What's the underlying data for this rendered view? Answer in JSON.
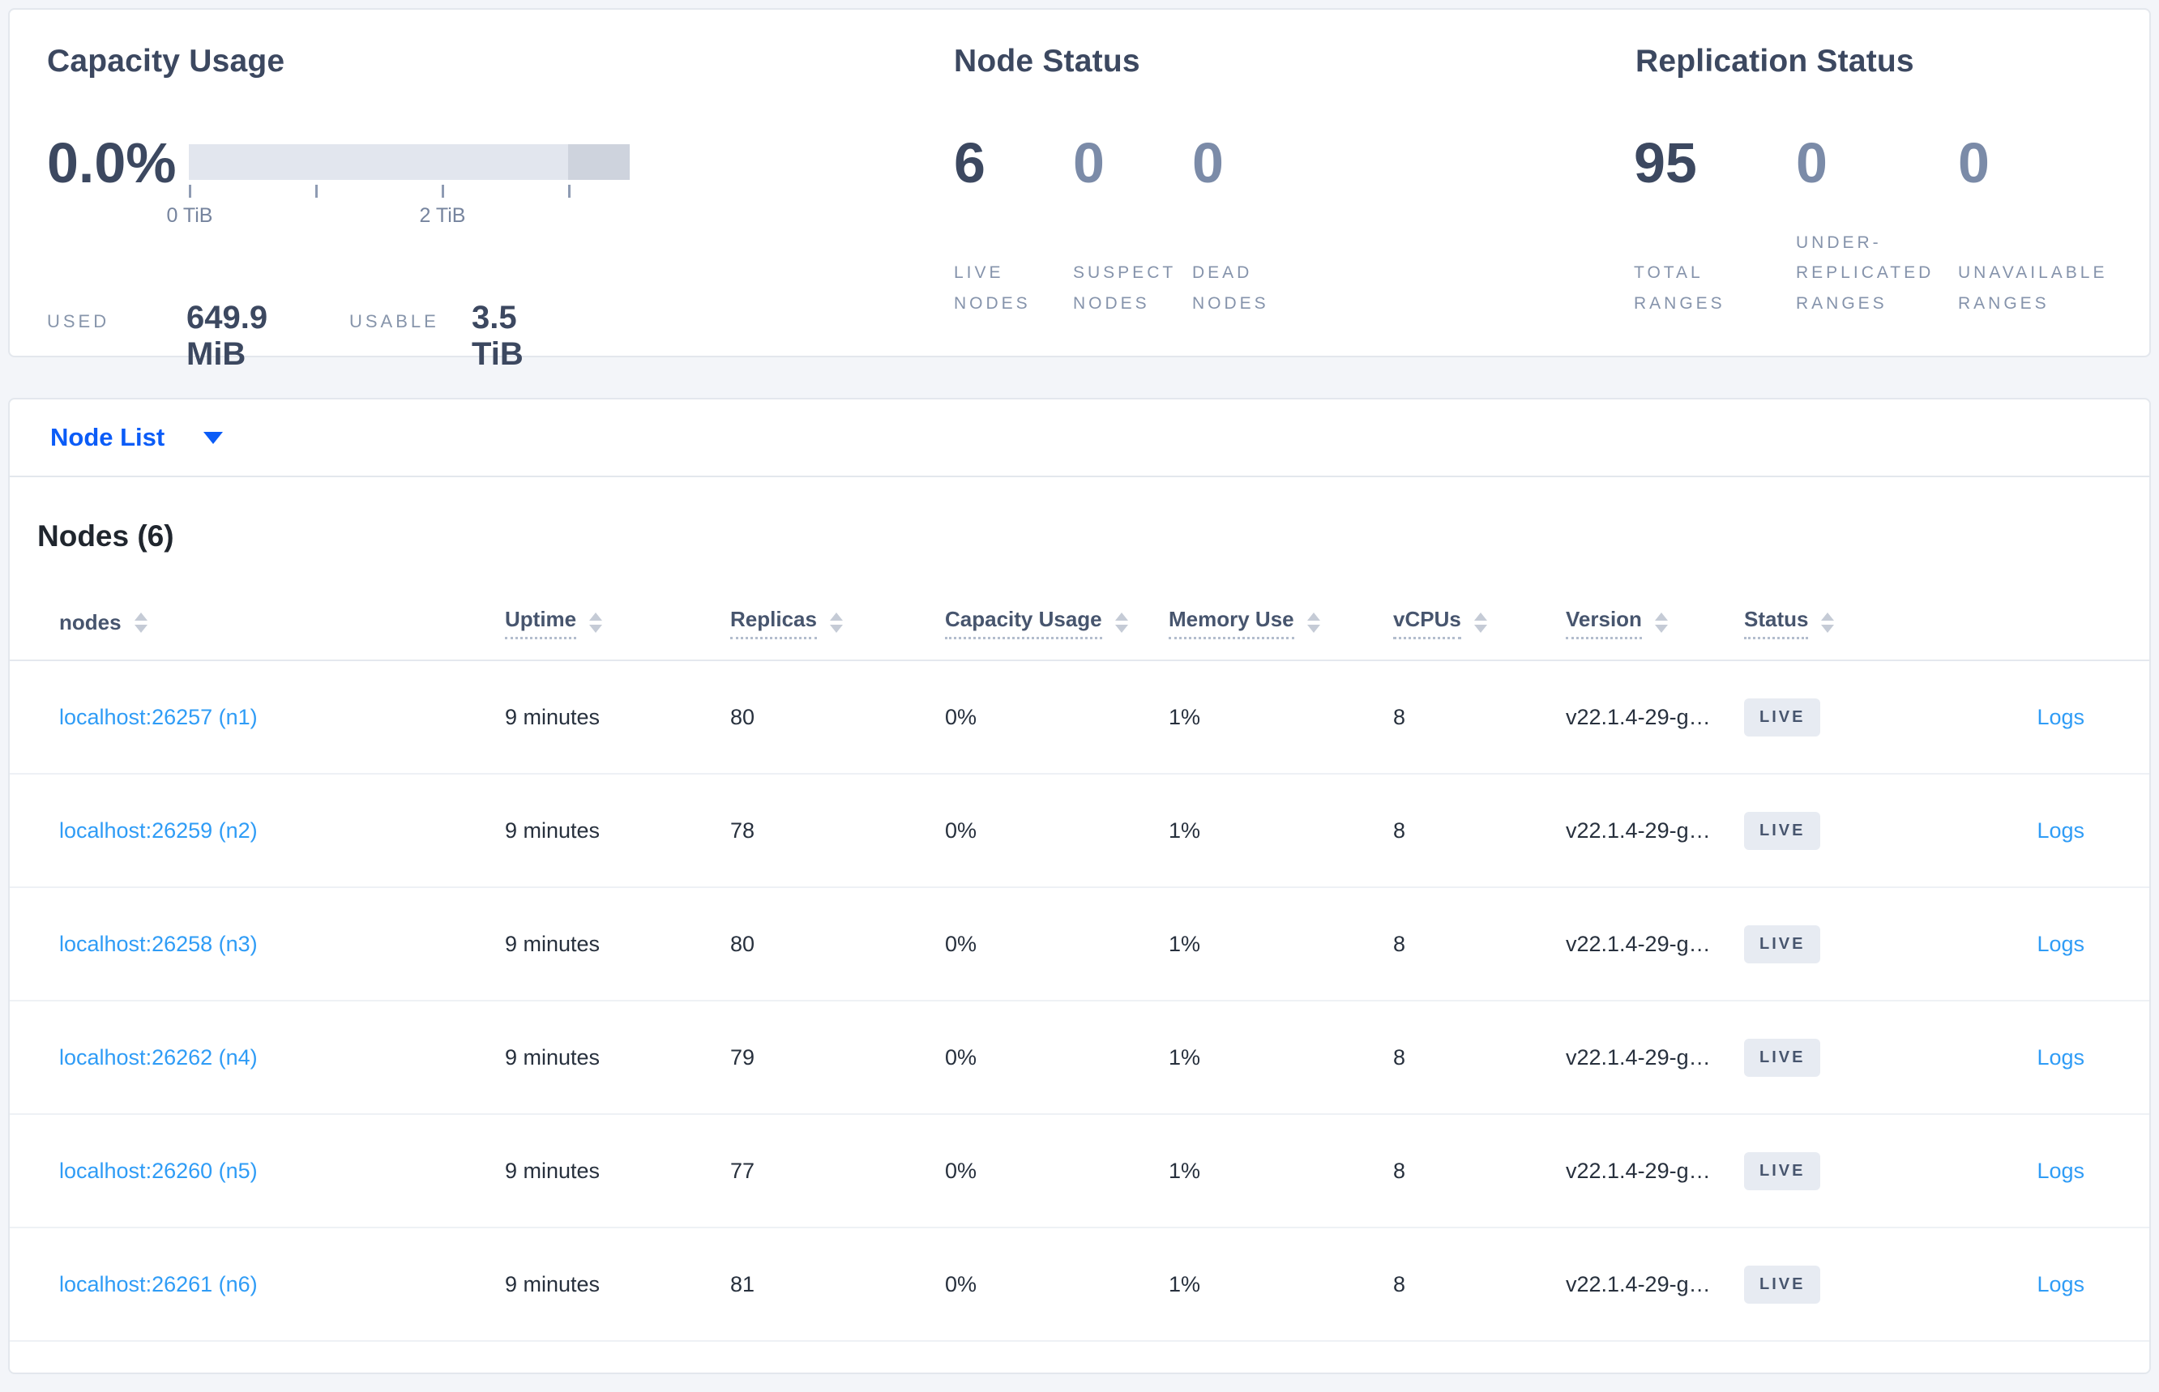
{
  "colors": {
    "primary_blue": "#0b5cf7",
    "link_blue": "#2f9cf6",
    "dark_slate": "#3c4860",
    "muted_label": "#8593ab",
    "badge_bg": "#e7ebf2",
    "bar_light": "#e2e6ee",
    "bar_dark": "#ced3dd"
  },
  "summary": {
    "capacity": {
      "title": "Capacity Usage",
      "percent": "0.0%",
      "tick_label_0": "0 TiB",
      "tick_label_2": "2 TiB",
      "used_label": "USED",
      "used_value": "649.9 MiB",
      "usable_label": "USABLE",
      "usable_value": "3.5 TiB"
    },
    "node_status": {
      "title": "Node Status",
      "stats": [
        {
          "value": "6",
          "label": "LIVE NODES"
        },
        {
          "value": "0",
          "label": "SUSPECT NODES"
        },
        {
          "value": "0",
          "label": "DEAD NODES"
        }
      ]
    },
    "replication": {
      "title": "Replication Status",
      "stats": [
        {
          "value": "95",
          "label": "TOTAL RANGES"
        },
        {
          "value": "0",
          "label": "UNDER-REPLICATED RANGES"
        },
        {
          "value": "0",
          "label": "UNAVAILABLE RANGES"
        }
      ]
    }
  },
  "view_selector": {
    "label": "Node List"
  },
  "nodes_table": {
    "title": "Nodes (6)",
    "columns": {
      "nodes": "nodes",
      "uptime": "Uptime",
      "replicas": "Replicas",
      "capacity": "Capacity Usage",
      "memory": "Memory Use",
      "vcpus": "vCPUs",
      "version": "Version",
      "status": "Status"
    },
    "rows": [
      {
        "address": "localhost:26257 (n1)",
        "uptime": "9 minutes",
        "replicas": "80",
        "capacity": "0%",
        "memory": "1%",
        "vcpus": "8",
        "version": "v22.1.4-29-g…",
        "status": "LIVE",
        "logs": "Logs"
      },
      {
        "address": "localhost:26259 (n2)",
        "uptime": "9 minutes",
        "replicas": "78",
        "capacity": "0%",
        "memory": "1%",
        "vcpus": "8",
        "version": "v22.1.4-29-g…",
        "status": "LIVE",
        "logs": "Logs"
      },
      {
        "address": "localhost:26258 (n3)",
        "uptime": "9 minutes",
        "replicas": "80",
        "capacity": "0%",
        "memory": "1%",
        "vcpus": "8",
        "version": "v22.1.4-29-g…",
        "status": "LIVE",
        "logs": "Logs"
      },
      {
        "address": "localhost:26262 (n4)",
        "uptime": "9 minutes",
        "replicas": "79",
        "capacity": "0%",
        "memory": "1%",
        "vcpus": "8",
        "version": "v22.1.4-29-g…",
        "status": "LIVE",
        "logs": "Logs"
      },
      {
        "address": "localhost:26260 (n5)",
        "uptime": "9 minutes",
        "replicas": "77",
        "capacity": "0%",
        "memory": "1%",
        "vcpus": "8",
        "version": "v22.1.4-29-g…",
        "status": "LIVE",
        "logs": "Logs"
      },
      {
        "address": "localhost:26261 (n6)",
        "uptime": "9 minutes",
        "replicas": "81",
        "capacity": "0%",
        "memory": "1%",
        "vcpus": "8",
        "version": "v22.1.4-29-g…",
        "status": "LIVE",
        "logs": "Logs"
      }
    ]
  }
}
